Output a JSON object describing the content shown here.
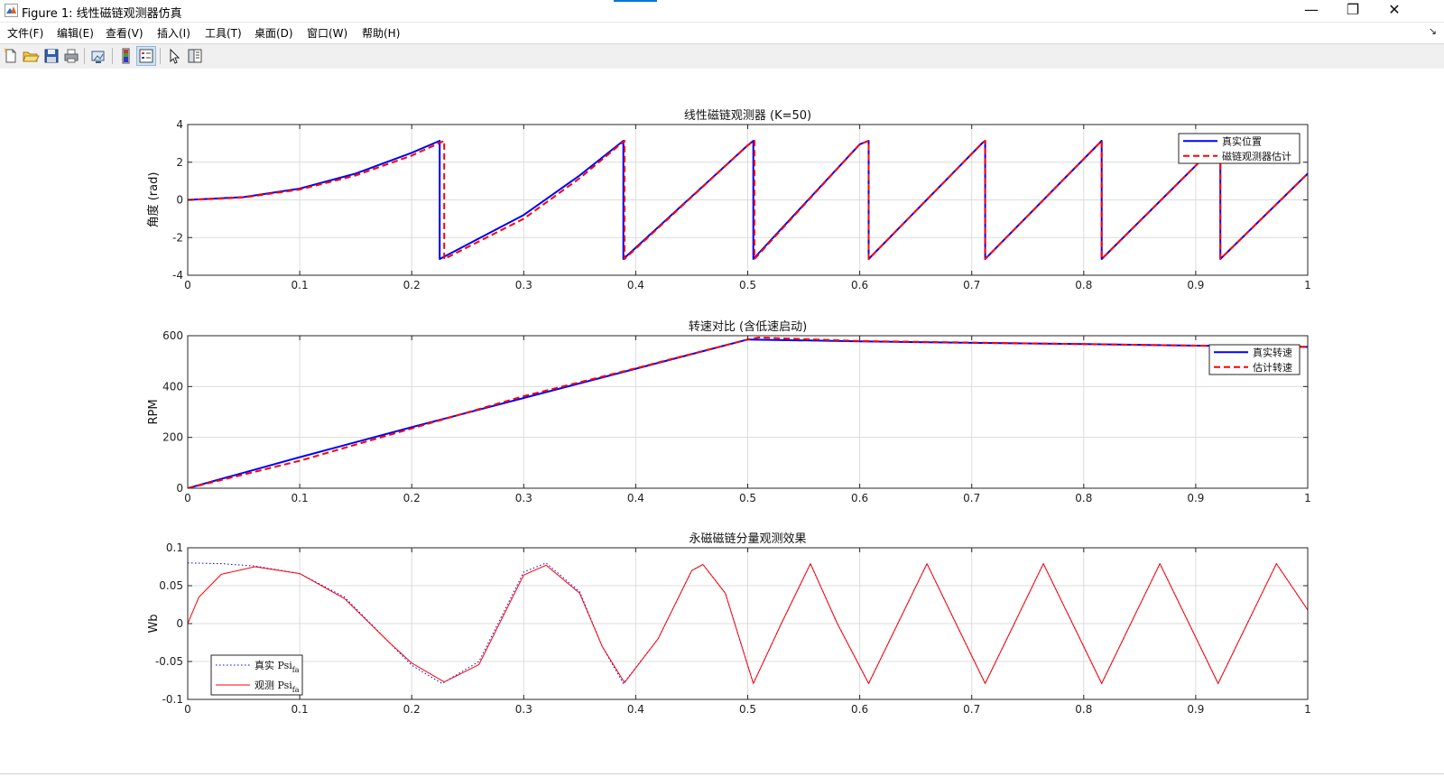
{
  "window": {
    "title": "Figure 1: 线性磁链观测器仿真",
    "controls": {
      "minimize": "—",
      "restore": "❐",
      "close": "✕"
    }
  },
  "menu": {
    "items": [
      "文件(F)",
      "编辑(E)",
      "查看(V)",
      "插入(I)",
      "工具(T)",
      "桌面(D)",
      "窗口(W)",
      "帮助(H)"
    ],
    "dock_arrow": "↘"
  },
  "toolbar": {
    "buttons": [
      {
        "icon": "new-figure-icon",
        "active": false
      },
      {
        "icon": "open-folder-icon",
        "active": false
      },
      {
        "icon": "save-disk-icon",
        "active": false
      },
      {
        "icon": "print-icon",
        "active": false
      },
      {
        "icon": "link-figure-icon",
        "active": false
      },
      {
        "icon": "colorbar-icon",
        "active": false
      },
      {
        "icon": "legend-icon",
        "active": true
      },
      {
        "icon": "pointer-arrow-icon",
        "active": false
      },
      {
        "icon": "property-inspector-icon",
        "active": false
      }
    ]
  },
  "colors": {
    "blue": "#0000ff",
    "red": "#ff0000",
    "grid": "#dcdcdc",
    "axis": "#262626"
  },
  "chart_data": [
    {
      "type": "line",
      "title": "线性磁链观测器 (K=50)",
      "xlabel": "",
      "ylabel": "角度 (rad)",
      "xlim": [
        0,
        1
      ],
      "ylim": [
        -4,
        4
      ],
      "xticks": [
        0,
        0.1,
        0.2,
        0.3,
        0.4,
        0.5,
        0.6,
        0.7,
        0.8,
        0.9,
        1
      ],
      "yticks": [
        -4,
        -2,
        0,
        2,
        4
      ],
      "grid": true,
      "legend": "top-right",
      "series": [
        {
          "name": "真实位置",
          "color": "#0000ff",
          "style": "solid",
          "width": 2,
          "x": [
            0,
            0.05,
            0.1,
            0.15,
            0.2,
            0.225,
            0.225,
            0.3,
            0.35,
            0.389,
            0.389,
            0.5,
            0.505,
            0.505,
            0.6,
            0.608,
            0.608,
            0.71,
            0.712,
            0.712,
            0.816,
            0.816,
            0.92,
            0.922,
            0.922,
            1.0
          ],
          "y": [
            0,
            0.15,
            0.6,
            1.4,
            2.5,
            3.14,
            -3.14,
            -0.8,
            1.3,
            3.14,
            -3.14,
            2.9,
            3.14,
            -3.14,
            2.95,
            3.14,
            -3.14,
            3.05,
            3.14,
            -3.14,
            3.14,
            -3.14,
            3.0,
            3.14,
            -3.14,
            1.4
          ]
        },
        {
          "name": "磁链观测器估计",
          "color": "#ff0000",
          "style": "dashed",
          "width": 2,
          "x": [
            0,
            0.05,
            0.1,
            0.15,
            0.2,
            0.229,
            0.229,
            0.3,
            0.35,
            0.39,
            0.39,
            0.5,
            0.506,
            0.506,
            0.6,
            0.608,
            0.608,
            0.71,
            0.712,
            0.712,
            0.816,
            0.816,
            0.92,
            0.922,
            0.922,
            1.0
          ],
          "y": [
            0,
            0.13,
            0.55,
            1.3,
            2.35,
            3.14,
            -3.14,
            -1.0,
            1.15,
            3.14,
            -3.14,
            2.9,
            3.14,
            -3.14,
            2.95,
            3.14,
            -3.14,
            3.05,
            3.14,
            -3.14,
            3.14,
            -3.14,
            3.0,
            3.14,
            -3.14,
            1.4
          ]
        }
      ]
    },
    {
      "type": "line",
      "title": "转速对比 (含低速启动)",
      "xlabel": "",
      "ylabel": "RPM",
      "xlim": [
        0,
        1
      ],
      "ylim": [
        0,
        600
      ],
      "xticks": [
        0,
        0.1,
        0.2,
        0.3,
        0.4,
        0.5,
        0.6,
        0.7,
        0.8,
        0.9,
        1
      ],
      "yticks": [
        0,
        200,
        400,
        600
      ],
      "grid": true,
      "legend": "top-right",
      "series": [
        {
          "name": "真实转速",
          "color": "#0000ff",
          "style": "solid",
          "width": 2,
          "x": [
            0,
            0.1,
            0.2,
            0.3,
            0.4,
            0.5,
            0.6,
            0.7,
            0.8,
            0.9,
            1.0
          ],
          "y": [
            0,
            122,
            240,
            355,
            470,
            585,
            578,
            572,
            567,
            561,
            556
          ]
        },
        {
          "name": "估计转速",
          "color": "#ff0000",
          "style": "dashed",
          "width": 2,
          "x": [
            0,
            0.1,
            0.2,
            0.3,
            0.4,
            0.5,
            0.51,
            0.6,
            0.7,
            0.8,
            0.9,
            1.0
          ],
          "y": [
            0,
            108,
            235,
            362,
            472,
            585,
            593,
            579,
            573,
            567,
            561,
            556
          ]
        }
      ]
    },
    {
      "type": "line",
      "title": "永磁磁链分量观测效果",
      "xlabel": "",
      "ylabel": "Wb",
      "xlim": [
        0,
        1
      ],
      "ylim": [
        -0.1,
        0.1
      ],
      "xticks": [
        0,
        0.1,
        0.2,
        0.3,
        0.4,
        0.5,
        0.6,
        0.7,
        0.8,
        0.9,
        1
      ],
      "yticks": [
        -0.1,
        -0.05,
        0,
        0.05,
        0.1
      ],
      "grid": true,
      "legend": "bottom-left",
      "series": [
        {
          "name": "真实 Psi_fa",
          "label_main": "真实 Psi",
          "label_sub": "fa",
          "color": "#0000ff",
          "style": "dotted",
          "width": 1,
          "x": [
            0,
            0.03,
            0.06,
            0.1,
            0.14,
            0.18,
            0.2,
            0.227,
            0.26,
            0.3,
            0.32,
            0.35,
            0.37,
            0.389,
            0.42,
            0.45,
            0.46,
            0.48,
            0.505,
            0.53,
            0.556,
            0.58,
            0.608,
            0.634,
            0.66,
            0.686,
            0.712,
            0.738,
            0.764,
            0.79,
            0.816,
            0.842,
            0.868,
            0.894,
            0.92,
            0.946,
            0.972,
            1.0
          ],
          "y": [
            0.08,
            0.079,
            0.076,
            0.066,
            0.035,
            -0.025,
            -0.055,
            -0.079,
            -0.05,
            0.068,
            0.08,
            0.042,
            -0.03,
            -0.079,
            -0.02,
            0.07,
            0.078,
            0.04,
            -0.079,
            0.0,
            0.079,
            0.0,
            -0.079,
            0.0,
            0.079,
            0.0,
            -0.079,
            0.0,
            0.079,
            0.0,
            -0.079,
            0.0,
            0.079,
            0.0,
            -0.079,
            0.0,
            0.079,
            0.018
          ]
        },
        {
          "name": "观测 Psi_fa",
          "label_main": "观测 Psi",
          "label_sub": "fa",
          "color": "#ff0000",
          "style": "solid",
          "width": 1,
          "x": [
            0,
            0.01,
            0.03,
            0.06,
            0.1,
            0.14,
            0.18,
            0.2,
            0.229,
            0.26,
            0.3,
            0.32,
            0.35,
            0.37,
            0.39,
            0.42,
            0.45,
            0.46,
            0.48,
            0.505,
            0.53,
            0.556,
            0.58,
            0.608,
            0.634,
            0.66,
            0.686,
            0.712,
            0.738,
            0.764,
            0.79,
            0.816,
            0.842,
            0.868,
            0.894,
            0.92,
            0.946,
            0.972,
            1.0
          ],
          "y": [
            0,
            0.035,
            0.065,
            0.075,
            0.066,
            0.033,
            -0.025,
            -0.052,
            -0.077,
            -0.054,
            0.064,
            0.077,
            0.04,
            -0.03,
            -0.078,
            -0.02,
            0.07,
            0.078,
            0.04,
            -0.079,
            0.0,
            0.079,
            0.0,
            -0.079,
            0.0,
            0.079,
            0.0,
            -0.079,
            0.0,
            0.079,
            0.0,
            -0.079,
            0.0,
            0.079,
            0.0,
            -0.079,
            0.0,
            0.079,
            0.018
          ]
        }
      ]
    }
  ]
}
